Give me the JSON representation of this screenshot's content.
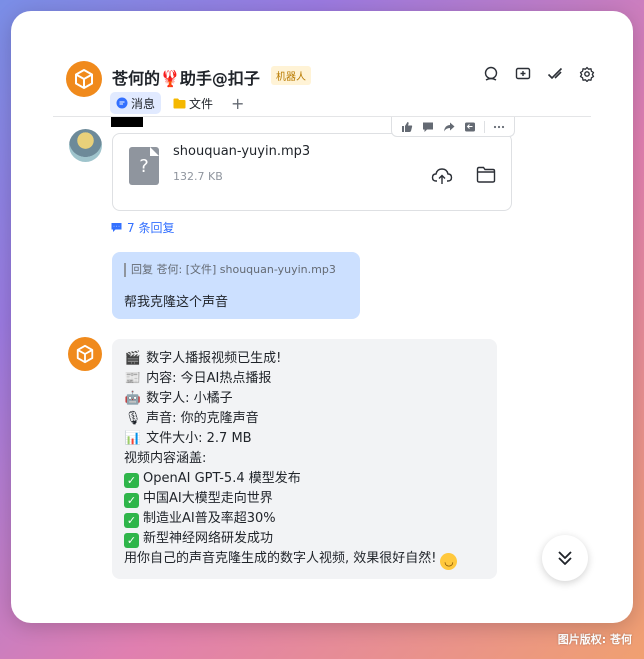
{
  "chat": {
    "title": "苍何的🦞助手@扣子",
    "badge": "机器人",
    "tabs": [
      {
        "label": "消息",
        "icon": "message-icon",
        "active": true
      },
      {
        "label": "文件",
        "icon": "folder-icon",
        "active": false
      }
    ],
    "add_tab": "+"
  },
  "header_tools": [
    "search-chat-icon",
    "add-chat-icon",
    "todo-check-icon",
    "settings-icon"
  ],
  "file_message": {
    "file_name": "shouquan-yuyin.mp3",
    "file_size": "132.7 KB",
    "file_icon_glyph": "?",
    "reply_count": "7 条回复",
    "hover_actions": [
      "thumbs-up-icon",
      "comment-icon",
      "forward-icon",
      "reply-icon",
      "more-icon"
    ]
  },
  "my_reply": {
    "quote": "回复 苍何: [文件] shouquan-yuyin.mp3",
    "text": "帮我克隆这个声音"
  },
  "bot_message": {
    "lines": [
      {
        "emoji": "🎬",
        "text": "数字人播报视频已生成!"
      },
      {
        "emoji": "📰",
        "text": "内容: 今日AI热点播报"
      },
      {
        "emoji": "🤖",
        "text": "数字人: 小橘子"
      },
      {
        "emoji": "🎙",
        "text": "声音: 你的克隆声音"
      },
      {
        "emoji": "📊",
        "text": "文件大小: 2.7 MB"
      },
      {
        "emoji": "",
        "text": "视频内容涵盖:"
      },
      {
        "check": true,
        "text": "OpenAI GPT-5.4 模型发布"
      },
      {
        "check": true,
        "text": "中国AI大模型走向世界"
      },
      {
        "check": true,
        "text": "制造业AI普及率超30%"
      },
      {
        "check": true,
        "text": "新型神经网络研发成功"
      }
    ],
    "closing": "用你自己的声音克隆生成的数字人视频, 效果很好自然!"
  },
  "watermark": "图片版权: 苍何",
  "colors": {
    "accent": "#3370ff",
    "bot_orange": "#f08a1c",
    "my_bubble": "#cce0ff",
    "check_green": "#2fb54a"
  }
}
